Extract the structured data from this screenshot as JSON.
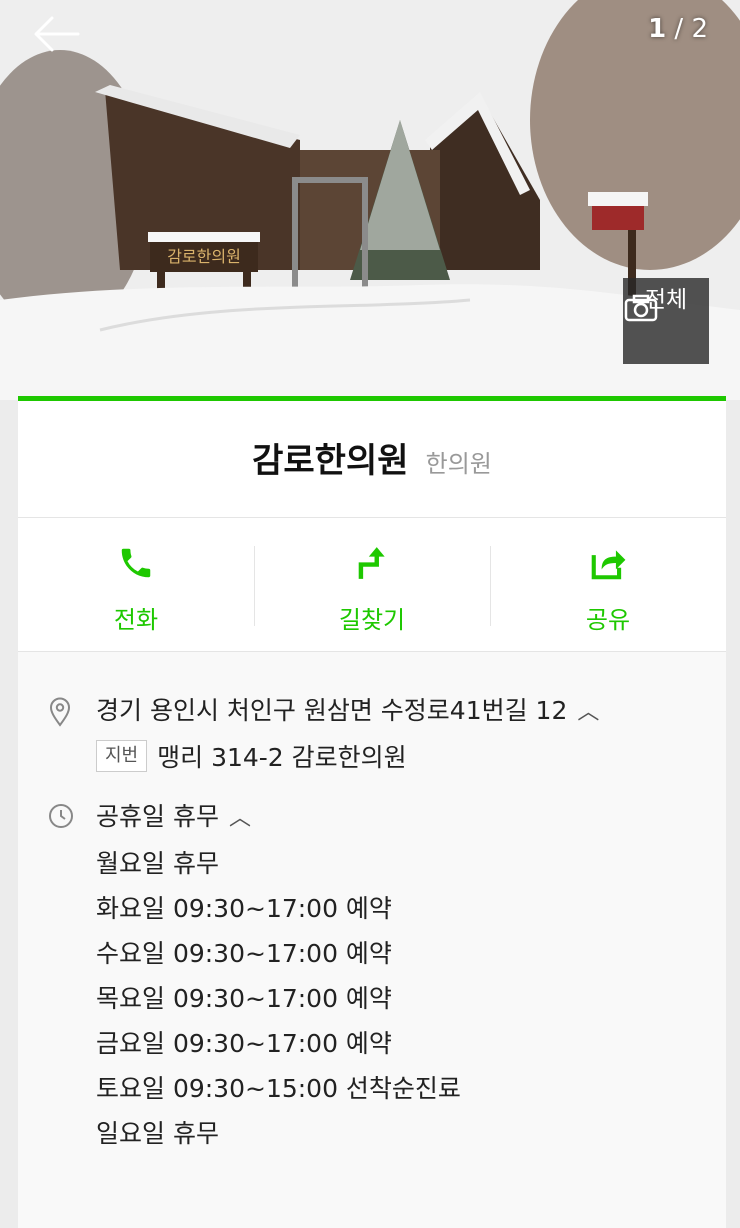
{
  "header": {
    "photo_counter_current": "1",
    "photo_counter_total": "/ 2",
    "all_photos_label": "전체"
  },
  "place": {
    "name": "감로한의원",
    "category": "한의원",
    "sign_text": "감로한의원"
  },
  "actions": [
    {
      "label": "전화",
      "icon": "phone-icon"
    },
    {
      "label": "길찾기",
      "icon": "directions-icon"
    },
    {
      "label": "공유",
      "icon": "share-icon"
    }
  ],
  "address": {
    "road": "경기 용인시 처인구 원삼면 수정로41번길 12",
    "jibun_tag": "지번",
    "jibun": "맹리 314-2 감로한의원",
    "toggle": "︿"
  },
  "hours": {
    "summary": "공휴일 휴무",
    "toggle": "︿",
    "days": [
      "월요일 휴무",
      "화요일 09:30~17:00 예약",
      "수요일 09:30~17:00 예약",
      "목요일 09:30~17:00 예약",
      "금요일 09:30~17:00 예약",
      "토요일 09:30~15:00 선착순진료",
      "일요일 휴무"
    ]
  },
  "colors": {
    "accent": "#1ec800"
  }
}
